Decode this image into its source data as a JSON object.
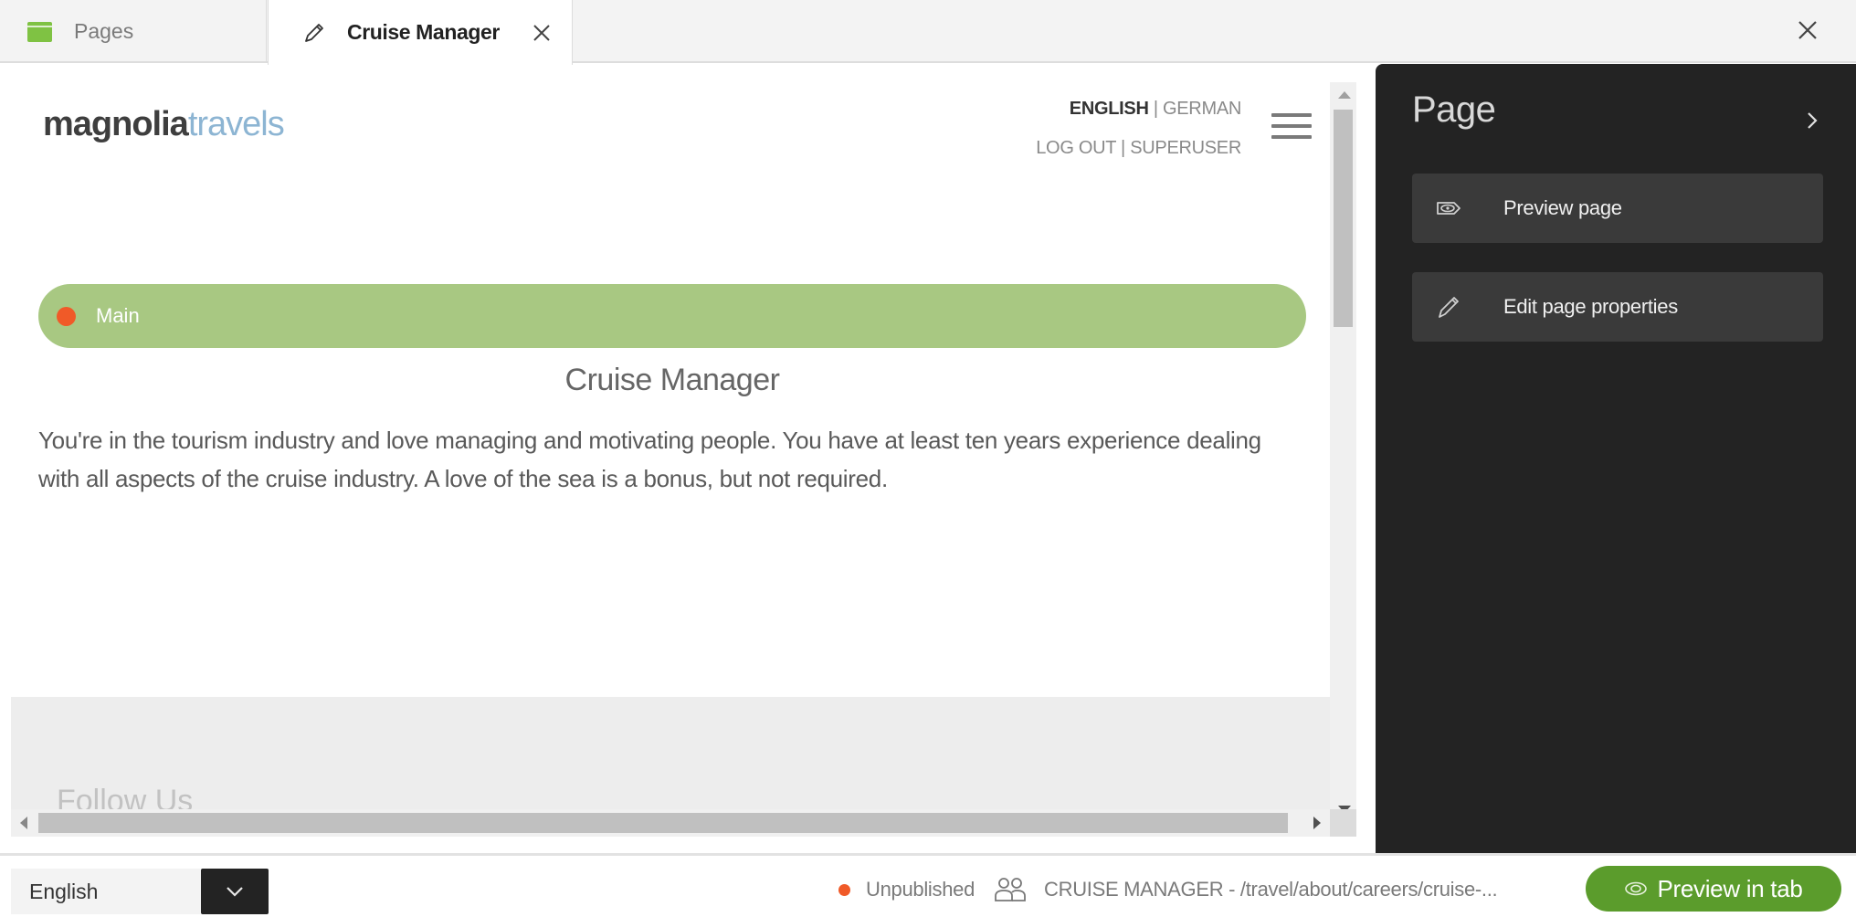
{
  "tabs": [
    {
      "label": "Pages",
      "icon": "pages-app-icon",
      "active": false
    },
    {
      "label": "Cruise Manager",
      "icon": "pencil-icon",
      "active": true,
      "closable": true
    }
  ],
  "app": {
    "close_icon": "close-icon"
  },
  "preview": {
    "logo": {
      "part1": "magnolia",
      "part2": "travels"
    },
    "language_switch": {
      "active": "ENGLISH",
      "separator": " | ",
      "other": "GERMAN"
    },
    "user_links": {
      "logout": "LOG OUT",
      "separator": " | ",
      "user": "SUPERUSER"
    },
    "menu_icon": "hamburger-icon",
    "area": {
      "label": "Main",
      "status_color": "#f05a28",
      "bar_color": "#a8c882"
    },
    "heading": "Cruise Manager",
    "body": "You're in the tourism industry and love managing and motivating people. You have at least ten years experience dealing with all aspects of the cruise industry. A love of the sea is a bonus, but not required.",
    "footer": {
      "follow_label": "Follow Us"
    }
  },
  "panel": {
    "title": "Page",
    "toggle_icon": "chevron-right-icon",
    "actions": [
      {
        "label": "Preview page",
        "icon": "preview-eye-icon"
      },
      {
        "label": "Edit page properties",
        "icon": "pencil-icon"
      }
    ]
  },
  "statusbar": {
    "language": {
      "selected": "English"
    },
    "publication_status": "Unpublished",
    "status_color": "#f05a28",
    "path": "CRUISE MANAGER - /travel/about/careers/cruise-...",
    "preview_button": "Preview in tab",
    "accent_color": "#5b9c2c"
  }
}
